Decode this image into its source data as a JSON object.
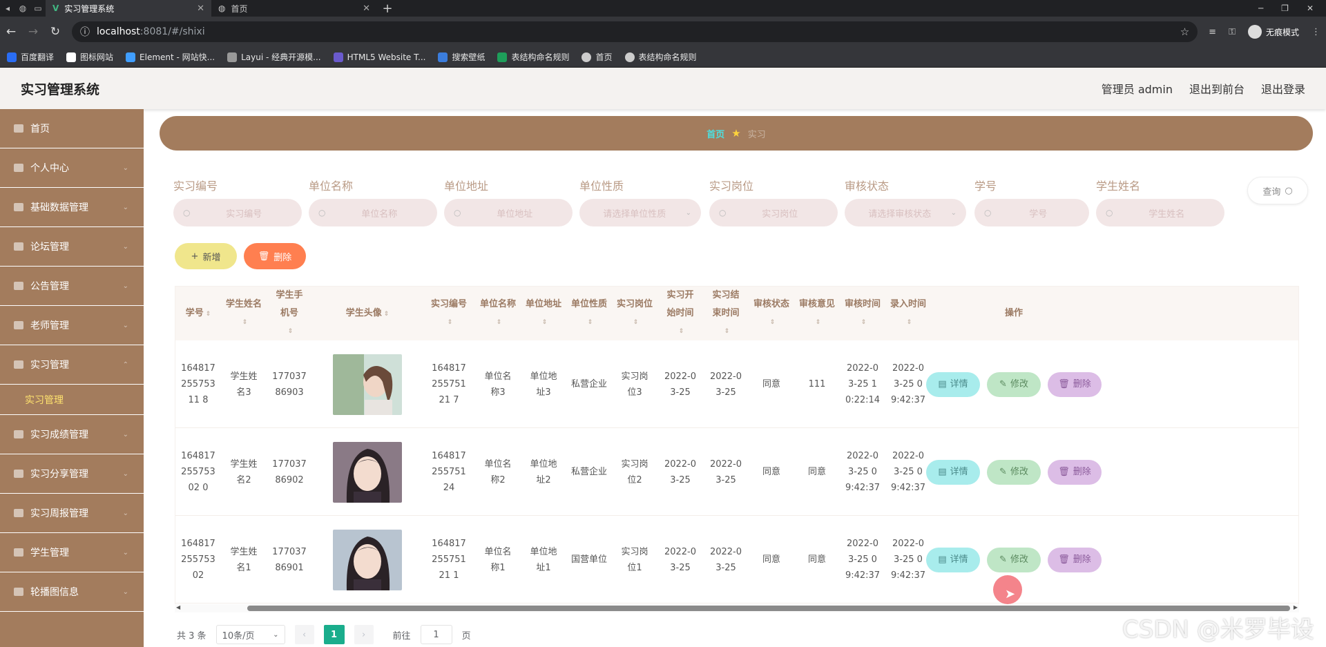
{
  "browser": {
    "tabs": [
      {
        "title": "实习管理系统",
        "active": true
      },
      {
        "title": "首页",
        "active": false
      }
    ],
    "url_host": "localhost",
    "url_path": ":8081/#/shixi",
    "profile_label": "无痕模式",
    "bookmarks": [
      "百度翻译",
      "图标网站",
      "Element - 网站快...",
      "Layui - 经典开源模...",
      "HTML5 Website T...",
      "搜索壁纸",
      "表结构命名规则",
      "首页",
      "表结构命名规则"
    ]
  },
  "header": {
    "title": "实习管理系统",
    "admin_label": "管理员 admin",
    "back_to_front": "退出到前台",
    "logout": "退出登录"
  },
  "sidebar": {
    "items": [
      {
        "label": "首页"
      },
      {
        "label": "个人中心"
      },
      {
        "label": "基础数据管理"
      },
      {
        "label": "论坛管理"
      },
      {
        "label": "公告管理"
      },
      {
        "label": "老师管理"
      },
      {
        "label": "实习管理"
      },
      {
        "label": "实习成绩管理"
      },
      {
        "label": "实习分享管理"
      },
      {
        "label": "实习周报管理"
      },
      {
        "label": "学生管理"
      },
      {
        "label": "轮播图信息"
      }
    ],
    "active_sub": "实习管理"
  },
  "breadcrumb": {
    "home": "首页",
    "current": "实习"
  },
  "search": {
    "fields": [
      {
        "label": "实习编号",
        "placeholder": "实习编号"
      },
      {
        "label": "单位名称",
        "placeholder": "单位名称"
      },
      {
        "label": "单位地址",
        "placeholder": "单位地址"
      },
      {
        "label": "单位性质",
        "placeholder": "请选择单位性质"
      },
      {
        "label": "实习岗位",
        "placeholder": "实习岗位"
      },
      {
        "label": "审核状态",
        "placeholder": "请选择审核状态"
      },
      {
        "label": "学号",
        "placeholder": "学号"
      },
      {
        "label": "学生姓名",
        "placeholder": "学生姓名"
      }
    ],
    "query_label": "查询"
  },
  "actions": {
    "add": "新增",
    "delete": "删除"
  },
  "table": {
    "headers": [
      "学号",
      "学生姓名",
      "学生手机号",
      "学生头像",
      "实习编号",
      "单位名称",
      "单位地址",
      "单位性质",
      "实习岗位",
      "实习开始时间",
      "实习结束时间",
      "审核状态",
      "审核意见",
      "审核时间",
      "录入时间",
      "操作"
    ],
    "rows": [
      {
        "xuehao": "16481725575311 8",
        "name": "学生姓名3",
        "phone": "17703786903",
        "shixi_no": "16481725575121 7",
        "unit_name": "单位名称3",
        "unit_addr": "单位地址3",
        "unit_type": "私营企业",
        "post": "实习岗位3",
        "start": "2022-03-25",
        "end": "2022-03-25",
        "status": "同意",
        "opinion": "111",
        "audit_time": "2022-03-25 10:22:14",
        "entry_time": "2022-03-25 09:42:37"
      },
      {
        "xuehao": "16481725575302 0",
        "name": "学生姓名2",
        "phone": "17703786902",
        "shixi_no": "16481725575124",
        "unit_name": "单位名称2",
        "unit_addr": "单位地址2",
        "unit_type": "私营企业",
        "post": "实习岗位2",
        "start": "2022-03-25",
        "end": "2022-03-25",
        "status": "同意",
        "opinion": "同意",
        "audit_time": "2022-03-25 09:42:37",
        "entry_time": "2022-03-25 09:42:37"
      },
      {
        "xuehao": "16481725575302",
        "name": "学生姓名1",
        "phone": "17703786901",
        "shixi_no": "16481725575121 1",
        "unit_name": "单位名称1",
        "unit_addr": "单位地址1",
        "unit_type": "国营单位",
        "post": "实习岗位1",
        "start": "2022-03-25",
        "end": "2022-03-25",
        "status": "同意",
        "opinion": "同意",
        "audit_time": "2022-03-25 09:42:37",
        "entry_time": "2022-03-25 09:42:37"
      }
    ],
    "op_labels": {
      "detail": "详情",
      "edit": "修改",
      "delete": "删除"
    }
  },
  "pagination": {
    "total": "共 3 条",
    "page_size": "10条/页",
    "current_page": "1",
    "goto_prefix": "前往",
    "goto_value": "1",
    "goto_suffix": "页"
  },
  "watermark": "CSDN @米罗毕设"
}
